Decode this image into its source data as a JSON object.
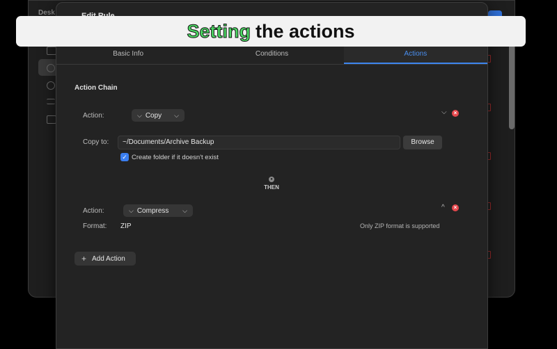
{
  "background": {
    "sidebar_title": "Desk"
  },
  "sheet": {
    "title": "Edit Rule",
    "tabs": [
      {
        "label": "Basic Info",
        "active": false
      },
      {
        "label": "Conditions",
        "active": false
      },
      {
        "label": "Actions",
        "active": true
      }
    ]
  },
  "action_chain": {
    "title": "Action Chain",
    "actions": [
      {
        "label": "Action:",
        "type": "Copy",
        "copy_to_label": "Copy to:",
        "path": "~/Documents/Archive Backup",
        "browse_label": "Browse",
        "create_folder_label": "Create folder if it doesn't exist",
        "create_folder_checked": true
      },
      {
        "label": "Action:",
        "type": "Compress",
        "format_label": "Format:",
        "format_value": "ZIP",
        "note": "Only ZIP format is supported"
      }
    ],
    "connector": "THEN",
    "add_action_label": "Add Action"
  },
  "banner": {
    "highlight": "Setting",
    "rest": "the actions",
    "highlight_color": "#4cd964"
  },
  "colors": {
    "accent": "#3d85ee",
    "danger": "#e5484d"
  }
}
